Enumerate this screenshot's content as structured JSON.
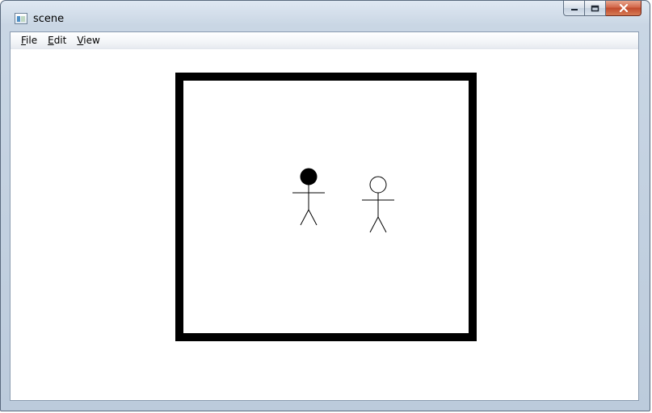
{
  "window": {
    "title": "scene",
    "icon": "app-window-icon"
  },
  "caption_buttons": {
    "minimize_icon": "minimize-icon",
    "maximize_icon": "maximize-icon",
    "close_icon": "close-icon"
  },
  "menu": {
    "items": [
      {
        "mnemonic": "F",
        "rest": "ile"
      },
      {
        "mnemonic": "E",
        "rest": "dit"
      },
      {
        "mnemonic": "V",
        "rest": "iew"
      }
    ]
  },
  "scene": {
    "figures": [
      {
        "name": "stick-figure-filled",
        "head_fill": "#000000"
      },
      {
        "name": "stick-figure-outline",
        "head_fill": "#ffffff"
      }
    ],
    "frame_color": "#000000"
  }
}
